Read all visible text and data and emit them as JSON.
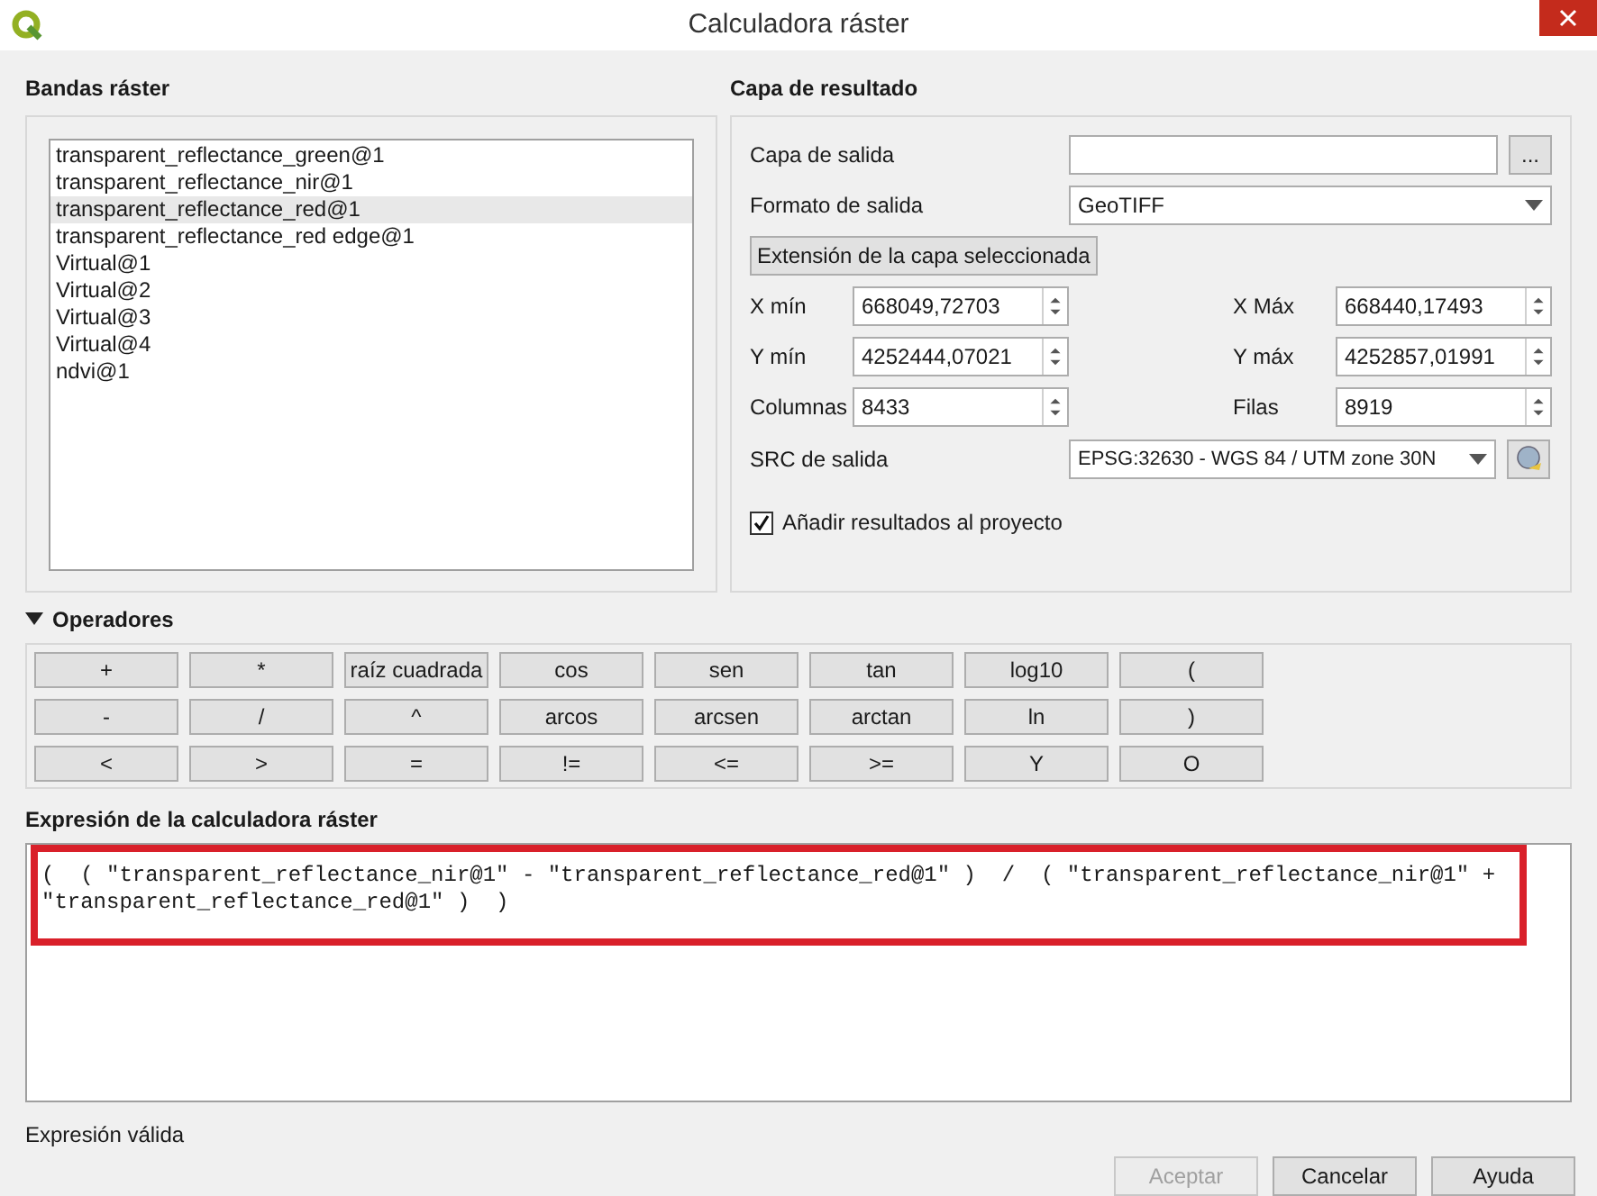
{
  "window": {
    "title": "Calculadora ráster"
  },
  "bands": {
    "title": "Bandas ráster",
    "items": [
      {
        "label": "transparent_reflectance_green@1",
        "selected": false
      },
      {
        "label": "transparent_reflectance_nir@1",
        "selected": false
      },
      {
        "label": "transparent_reflectance_red@1",
        "selected": true
      },
      {
        "label": "transparent_reflectance_red edge@1",
        "selected": false
      },
      {
        "label": "Virtual@1",
        "selected": false
      },
      {
        "label": "Virtual@2",
        "selected": false
      },
      {
        "label": "Virtual@3",
        "selected": false
      },
      {
        "label": "Virtual@4",
        "selected": false
      },
      {
        "label": "ndvi@1",
        "selected": false
      }
    ]
  },
  "result": {
    "title": "Capa de resultado",
    "output_label": "Capa de salida",
    "browse": "...",
    "format_label": "Formato de salida",
    "format": "GeoTIFF",
    "extent_button": "Extensión de la capa seleccionada",
    "coords": [
      {
        "label": "X mín",
        "value": "668049,72703"
      },
      {
        "label": "X Máx",
        "value": "668440,17493"
      },
      {
        "label": "Y mín",
        "value": "4252444,07021"
      },
      {
        "label": "Y máx",
        "value": "4252857,01991"
      },
      {
        "label": "Columnas",
        "value": "8433"
      },
      {
        "label": "Filas",
        "value": "8919"
      }
    ],
    "crs_label": "SRC de salida",
    "crs": "EPSG:32630 - WGS 84 / UTM zone 30N",
    "add_to_project": {
      "label": "Añadir resultados al proyecto",
      "checked": true
    }
  },
  "operators": {
    "title": "Operadores",
    "expanded": true,
    "rows": [
      [
        "+",
        "*",
        "raíz cuadrada",
        "cos",
        "sen",
        "tan",
        "log10",
        "("
      ],
      [
        "-",
        "/",
        "^",
        "arcos",
        "arcsen",
        "arctan",
        "ln",
        ")"
      ],
      [
        "<",
        ">",
        "=",
        "!=",
        "<=",
        ">=",
        "Y",
        "O"
      ]
    ]
  },
  "expression": {
    "title": "Expresión de la calculadora ráster",
    "value": "(  ( \"transparent_reflectance_nir@1\" - \"transparent_reflectance_red@1\" )  /  ( \"transparent_reflectance_nir@1\" + \"transparent_reflectance_red@1\" )  )",
    "highlighted": true
  },
  "status": "Expresión válida",
  "buttons": [
    {
      "label": "Aceptar",
      "disabled": true
    },
    {
      "label": "Cancelar",
      "disabled": false
    },
    {
      "label": "Ayuda",
      "disabled": false
    }
  ]
}
